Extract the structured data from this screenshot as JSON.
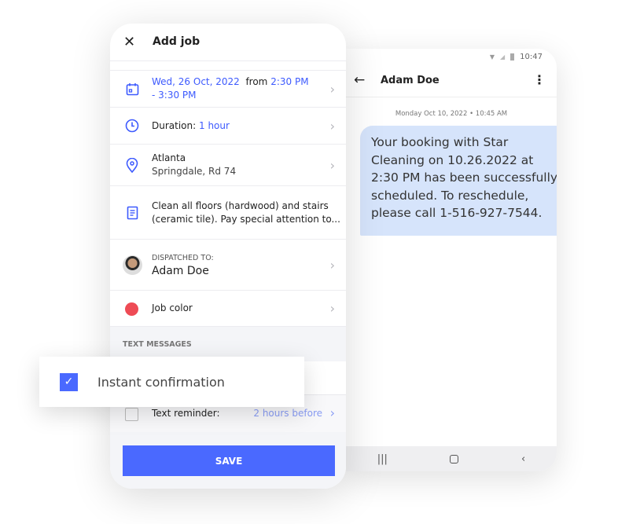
{
  "job_form": {
    "title": "Add job",
    "date": "Wed, 26 Oct, 2022",
    "from_label": "from",
    "time_start": "2:30 PM -",
    "time_end": "3:30 PM",
    "duration_label": "Duration:",
    "duration_value": "1 hour",
    "location_city": "Atlanta",
    "location_street": "Springdale, Rd 74",
    "notes_line1": "Clean all floors (hardwood) and stairs",
    "notes_line2": "(ceramic tile). Pay special attention to...",
    "dispatched_label": "DISPATCHED TO:",
    "dispatched_name": "Adam Doe",
    "job_color_label": "Job color",
    "job_color": "#ee4b55",
    "section_text_messages": "TEXT MESSAGES",
    "reminder_label": "Text reminder:",
    "reminder_value": "2 hours before",
    "reminder_checked": false,
    "save_label": "SAVE",
    "accent": "#4a69ff"
  },
  "instant_confirmation": {
    "label": "Instant confirmation",
    "checked": true
  },
  "sms_screen": {
    "status_time": "10:47",
    "contact_name": "Adam Doe",
    "message_timestamp": "Monday Oct 10, 2022 • 10:45 AM",
    "message_text": "Your booking with Star Cleaning on 10.26.2022 at 2:30 PM has been successfully scheduled. To reschedule, please call 1-516-927-7544.",
    "bubble_color": "#d6e4fb"
  }
}
